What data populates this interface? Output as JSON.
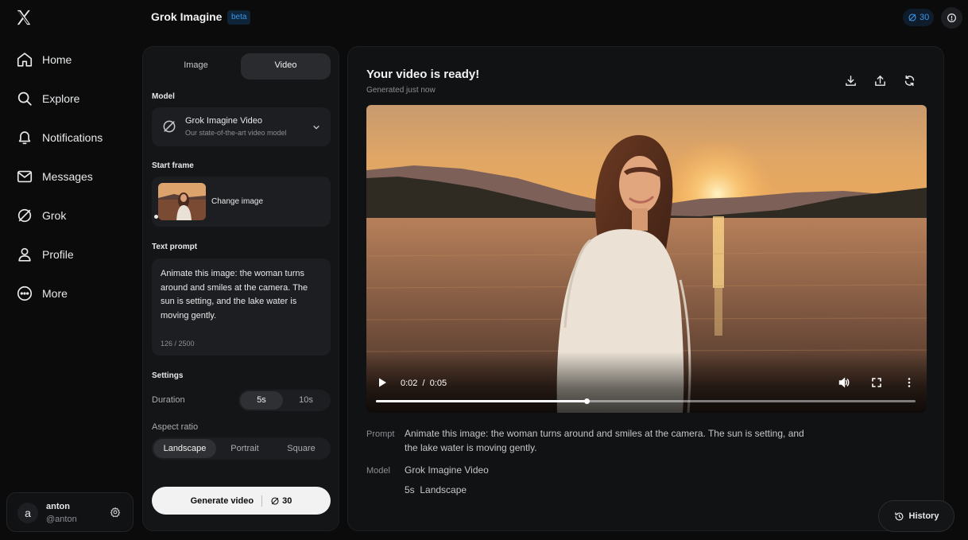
{
  "nav": {
    "items": [
      {
        "label": "Home",
        "icon": "home-icon"
      },
      {
        "label": "Explore",
        "icon": "search-icon"
      },
      {
        "label": "Notifications",
        "icon": "bell-icon"
      },
      {
        "label": "Messages",
        "icon": "mail-icon"
      },
      {
        "label": "Grok",
        "icon": "grok-icon"
      },
      {
        "label": "Profile",
        "icon": "person-icon"
      },
      {
        "label": "More",
        "icon": "more-circle-icon"
      }
    ],
    "account": {
      "avatar_letter": "a",
      "name": "anton",
      "handle": "@anton"
    }
  },
  "header": {
    "title": "Grok Imagine",
    "badge": "beta",
    "credits": "30"
  },
  "settings": {
    "tabs": [
      "Image",
      "Video"
    ],
    "active_tab": "Video",
    "model_label": "Model",
    "model": {
      "name": "Grok Imagine Video",
      "description": "Our state-of-the-art video model"
    },
    "start_frame_label": "Start frame",
    "change_image": "Change image",
    "text_prompt_label": "Text prompt",
    "prompt": "Animate this image: the woman turns around and smiles at the camera. The sun is setting, and the lake water is moving gently.",
    "char_count": "126 / 2500",
    "settings_label": "Settings",
    "duration": {
      "label": "Duration",
      "options": [
        "5s",
        "10s"
      ],
      "selected": "5s"
    },
    "aspect_ratio": {
      "label": "Aspect ratio",
      "options": [
        "Landscape",
        "Portrait",
        "Square"
      ],
      "selected": "Landscape"
    },
    "generate": {
      "label": "Generate video",
      "cost": "30"
    }
  },
  "result": {
    "title": "Your video is ready!",
    "subtitle": "Generated just now",
    "actions": [
      "download-icon",
      "share-icon",
      "regenerate-icon"
    ],
    "video": {
      "current_time": "0:02",
      "separator": "/",
      "duration": "0:05",
      "progress": 0.39
    },
    "prompt_key": "Prompt",
    "prompt_value": "Animate this image: the woman turns around and smiles at the camera. The sun is setting, and the lake water is moving gently.",
    "model_key": "Model",
    "model_value": "Grok Imagine Video",
    "model_detail": "5s  Landscape",
    "history": "History"
  },
  "colors": {
    "accent": "#3d97e8",
    "background": "#0b0b0c",
    "panel": "#141517",
    "primary_button": "#f2f2f2"
  }
}
